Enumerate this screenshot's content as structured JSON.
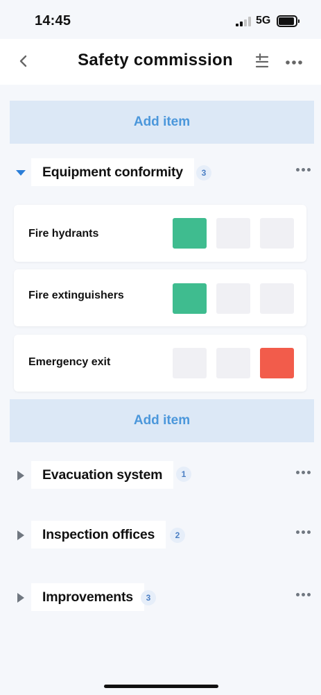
{
  "status_bar": {
    "time": "14:45",
    "network": "5G"
  },
  "header": {
    "title": "Safety commission"
  },
  "add_item_label": "Add item",
  "sections": [
    {
      "title": "Equipment conformity",
      "count": "3",
      "expanded": true
    },
    {
      "title": "Evacuation system",
      "count": "1",
      "expanded": false
    },
    {
      "title": "Inspection offices",
      "count": "2",
      "expanded": false
    },
    {
      "title": "Improvements",
      "count": "3",
      "expanded": false
    }
  ],
  "items": [
    {
      "label": "Fire hydrants",
      "states": [
        "green",
        "empty",
        "empty"
      ]
    },
    {
      "label": "Fire extinguishers",
      "states": [
        "green",
        "empty",
        "empty"
      ]
    },
    {
      "label": "Emergency exit",
      "states": [
        "empty",
        "empty",
        "red"
      ]
    }
  ],
  "colors": {
    "green": "#3fbc8f",
    "red": "#f25c4b",
    "accent": "#4b97db",
    "add_bg": "#dce8f6"
  },
  "icons": [
    "back-chevron-icon",
    "sort-icon",
    "more-icon",
    "caret-down-icon",
    "caret-right-icon"
  ]
}
